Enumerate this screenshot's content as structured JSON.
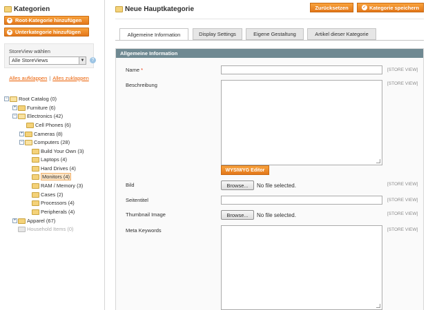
{
  "sidebar": {
    "title": "Kategorien",
    "add_root_label": "Root-Kategorie hinzufügen",
    "add_sub_label": "Unterkategorie hinzufügen",
    "storeview_label": "StoreView wählen",
    "storeview_selected": "Alle StoreViews",
    "expand_all": "Alles aufklappen",
    "separator": "|",
    "collapse_all": "Alles zuklappen",
    "tree": [
      {
        "label": "Root Catalog (0)",
        "toggle": "−",
        "state": "open"
      },
      {
        "label": "Furniture (6)",
        "toggle": "+",
        "state": "closed"
      },
      {
        "label": "Electronics (42)",
        "toggle": "−",
        "state": "open"
      },
      {
        "label": "Cell Phones (6)",
        "toggle": "",
        "state": "leaf"
      },
      {
        "label": "Cameras (8)",
        "toggle": "+",
        "state": "closed"
      },
      {
        "label": "Computers (28)",
        "toggle": "−",
        "state": "open"
      },
      {
        "label": "Build Your Own (3)",
        "toggle": "",
        "state": "leaf"
      },
      {
        "label": "Laptops (4)",
        "toggle": "",
        "state": "leaf"
      },
      {
        "label": "Hard Drives (4)",
        "toggle": "",
        "state": "leaf"
      },
      {
        "label": "Monitors (4)",
        "toggle": "",
        "state": "selected"
      },
      {
        "label": "RAM / Memory (3)",
        "toggle": "",
        "state": "leaf"
      },
      {
        "label": "Cases (2)",
        "toggle": "",
        "state": "leaf"
      },
      {
        "label": "Processors (4)",
        "toggle": "",
        "state": "leaf"
      },
      {
        "label": "Peripherals (4)",
        "toggle": "",
        "state": "leaf"
      },
      {
        "label": "Apparel (67)",
        "toggle": "+",
        "state": "closed"
      },
      {
        "label": "Household Items (0)",
        "toggle": "",
        "state": "disabled"
      }
    ]
  },
  "main": {
    "title": "Neue Hauptkategorie",
    "reset_label": "Zurücksetzen",
    "save_label": "Kategorie speichern",
    "tabs": [
      {
        "label": "Allgemeine Information"
      },
      {
        "label": "Display Settings"
      },
      {
        "label": "Eigene Gestaltung"
      },
      {
        "label": "Artikel dieser Kategorie"
      }
    ],
    "panel_title": "Allgemeine Information",
    "fields": {
      "name_label": "Name",
      "required_mark": "*",
      "description_label": "Beschreibung",
      "wysiwyg_label": "WYSIWYG Editor",
      "image_label": "Bild",
      "page_title_label": "Seitentitel",
      "thumbnail_label": "Thumbnail Image",
      "meta_keywords_label": "Meta Keywords",
      "browse_label": "Browse...",
      "no_file_text": "No file selected.",
      "scope_text": "[STORE VIEW]"
    }
  },
  "colors": {
    "accent": "#e3771a",
    "panel_header": "#6f8992",
    "link": "#eb5e00"
  }
}
